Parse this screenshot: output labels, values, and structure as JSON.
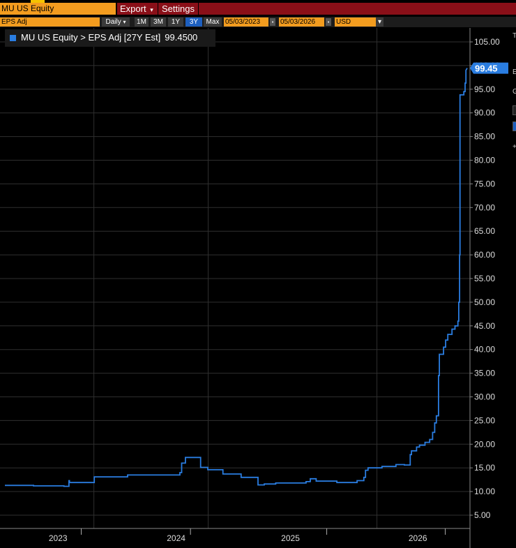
{
  "security": "MU US Equity",
  "menu": {
    "export_label": "Export",
    "export_arrow": "▾",
    "settings_label": "Settings"
  },
  "toolbar": {
    "field": "EPS Adj",
    "frequency": "Daily",
    "frequency_arrow": "▾",
    "ranges": [
      "1M",
      "3M",
      "1Y",
      "3Y",
      "Max"
    ],
    "active_range": "3Y",
    "start_date": "05/03/2023",
    "end_date": "05/03/2026",
    "currency": "USD",
    "currency_arrow": "▾",
    "calendar_icon": "calendar-icon"
  },
  "legend": {
    "label": "MU US Equity > EPS Adj [27Y Est]",
    "value": "99.4500"
  },
  "side_panel_letters": [
    "T",
    "E",
    "G",
    "+"
  ],
  "colors": {
    "series": "#2a7de1",
    "accent_orange": "#f39c1f",
    "menu_red": "#8a0f18",
    "active_blue": "#1d5fbf"
  },
  "chart_data": {
    "type": "line",
    "title": "",
    "xlabel": "",
    "ylabel": "",
    "ylim": [
      2.2,
      109.2
    ],
    "y_ticks": [
      "5.00",
      "10.00",
      "15.00",
      "20.00",
      "25.00",
      "30.00",
      "35.00",
      "40.00",
      "45.00",
      "50.00",
      "55.00",
      "60.00",
      "65.00",
      "70.00",
      "75.00",
      "80.00",
      "85.00",
      "90.00",
      "95.00",
      "100.00",
      "105.00"
    ],
    "x_range": [
      "2023-05-03",
      "2026-05-03"
    ],
    "year_labels": [
      {
        "label": "2023",
        "date": "2023-09-06"
      },
      {
        "label": "2024",
        "date": "2024-06-12"
      },
      {
        "label": "2025",
        "date": "2025-03-10"
      },
      {
        "label": "2026",
        "date": "2026-01-06"
      }
    ],
    "x_ticks": [
      "2023-10-31",
      "2024-07-16",
      "2025-06-04",
      "2026-03-12"
    ],
    "v_gridlines": [
      "2023-11-30",
      "2024-08-27",
      "2025-10-01"
    ],
    "last_value_label": "99.45",
    "series": [
      {
        "points": [
          [
            "2023-05-03",
            11.3
          ],
          [
            "2023-07-10",
            11.3
          ],
          [
            "2023-07-10",
            11.2
          ],
          [
            "2023-09-20",
            11.2
          ],
          [
            "2023-09-20",
            11.1
          ],
          [
            "2023-10-02",
            11.1
          ],
          [
            "2023-10-02",
            12.3
          ],
          [
            "2023-10-03",
            12.3
          ],
          [
            "2023-10-03",
            11.9
          ],
          [
            "2023-12-01",
            11.9
          ],
          [
            "2023-12-01",
            13.1
          ],
          [
            "2024-02-18",
            13.1
          ],
          [
            "2024-02-18",
            13.5
          ],
          [
            "2024-06-21",
            13.5
          ],
          [
            "2024-06-21",
            14.0
          ],
          [
            "2024-06-25",
            14.0
          ],
          [
            "2024-06-25",
            16.0
          ],
          [
            "2024-07-04",
            16.0
          ],
          [
            "2024-07-04",
            17.2
          ],
          [
            "2024-08-09",
            17.2
          ],
          [
            "2024-08-09",
            15.1
          ],
          [
            "2024-08-26",
            15.1
          ],
          [
            "2024-08-26",
            14.6
          ],
          [
            "2024-10-01",
            14.6
          ],
          [
            "2024-10-01",
            13.7
          ],
          [
            "2024-11-13",
            13.7
          ],
          [
            "2024-11-13",
            13.0
          ],
          [
            "2024-12-23",
            13.0
          ],
          [
            "2024-12-23",
            11.4
          ],
          [
            "2025-01-07",
            11.4
          ],
          [
            "2025-01-07",
            11.6
          ],
          [
            "2025-02-03",
            11.6
          ],
          [
            "2025-02-03",
            11.8
          ],
          [
            "2025-04-16",
            11.8
          ],
          [
            "2025-04-16",
            12.1
          ],
          [
            "2025-04-26",
            12.1
          ],
          [
            "2025-04-26",
            12.7
          ],
          [
            "2025-05-10",
            12.7
          ],
          [
            "2025-05-10",
            12.2
          ],
          [
            "2025-06-28",
            12.2
          ],
          [
            "2025-06-28",
            11.9
          ],
          [
            "2025-08-15",
            11.9
          ],
          [
            "2025-08-15",
            12.3
          ],
          [
            "2025-08-31",
            12.3
          ],
          [
            "2025-08-31",
            13.0
          ],
          [
            "2025-09-04",
            13.0
          ],
          [
            "2025-09-04",
            14.5
          ],
          [
            "2025-09-10",
            14.5
          ],
          [
            "2025-09-10",
            15.0
          ],
          [
            "2025-10-13",
            15.0
          ],
          [
            "2025-10-13",
            15.3
          ],
          [
            "2025-11-15",
            15.3
          ],
          [
            "2025-11-15",
            15.7
          ],
          [
            "2025-12-05",
            15.7
          ],
          [
            "2025-12-05",
            15.6
          ],
          [
            "2025-12-19",
            15.6
          ],
          [
            "2025-12-19",
            17.8
          ],
          [
            "2025-12-22",
            17.8
          ],
          [
            "2025-12-22",
            18.6
          ],
          [
            "2026-01-03",
            18.6
          ],
          [
            "2026-01-03",
            19.4
          ],
          [
            "2026-01-10",
            19.4
          ],
          [
            "2026-01-10",
            19.8
          ],
          [
            "2026-01-23",
            19.8
          ],
          [
            "2026-01-23",
            20.4
          ],
          [
            "2026-02-03",
            20.4
          ],
          [
            "2026-02-03",
            21.0
          ],
          [
            "2026-02-10",
            21.0
          ],
          [
            "2026-02-10",
            22.5
          ],
          [
            "2026-02-15",
            22.5
          ],
          [
            "2026-02-15",
            24.5
          ],
          [
            "2026-02-19",
            24.5
          ],
          [
            "2026-02-19",
            26.0
          ],
          [
            "2026-02-24",
            26.0
          ],
          [
            "2026-02-24",
            34.5
          ],
          [
            "2026-02-26",
            34.5
          ],
          [
            "2026-02-26",
            39.0
          ],
          [
            "2026-03-08",
            39.0
          ],
          [
            "2026-03-08",
            40.5
          ],
          [
            "2026-03-13",
            40.5
          ],
          [
            "2026-03-13",
            42.0
          ],
          [
            "2026-03-18",
            42.0
          ],
          [
            "2026-03-18",
            43.2
          ],
          [
            "2026-03-28",
            43.2
          ],
          [
            "2026-03-28",
            44.3
          ],
          [
            "2026-04-04",
            44.3
          ],
          [
            "2026-04-04",
            45.0
          ],
          [
            "2026-04-11",
            45.0
          ],
          [
            "2026-04-11",
            46.0
          ],
          [
            "2026-04-13",
            46.0
          ],
          [
            "2026-04-13",
            50.0
          ],
          [
            "2026-04-15",
            50.0
          ],
          [
            "2026-04-15",
            60.0
          ],
          [
            "2026-04-16",
            60.0
          ],
          [
            "2026-04-16",
            93.8
          ],
          [
            "2026-04-25",
            93.8
          ],
          [
            "2026-04-25",
            94.5
          ],
          [
            "2026-04-28",
            94.5
          ],
          [
            "2026-04-28",
            96.3
          ],
          [
            "2026-04-30",
            96.3
          ],
          [
            "2026-04-30",
            99.0
          ],
          [
            "2026-05-03",
            99.45
          ]
        ]
      }
    ]
  }
}
